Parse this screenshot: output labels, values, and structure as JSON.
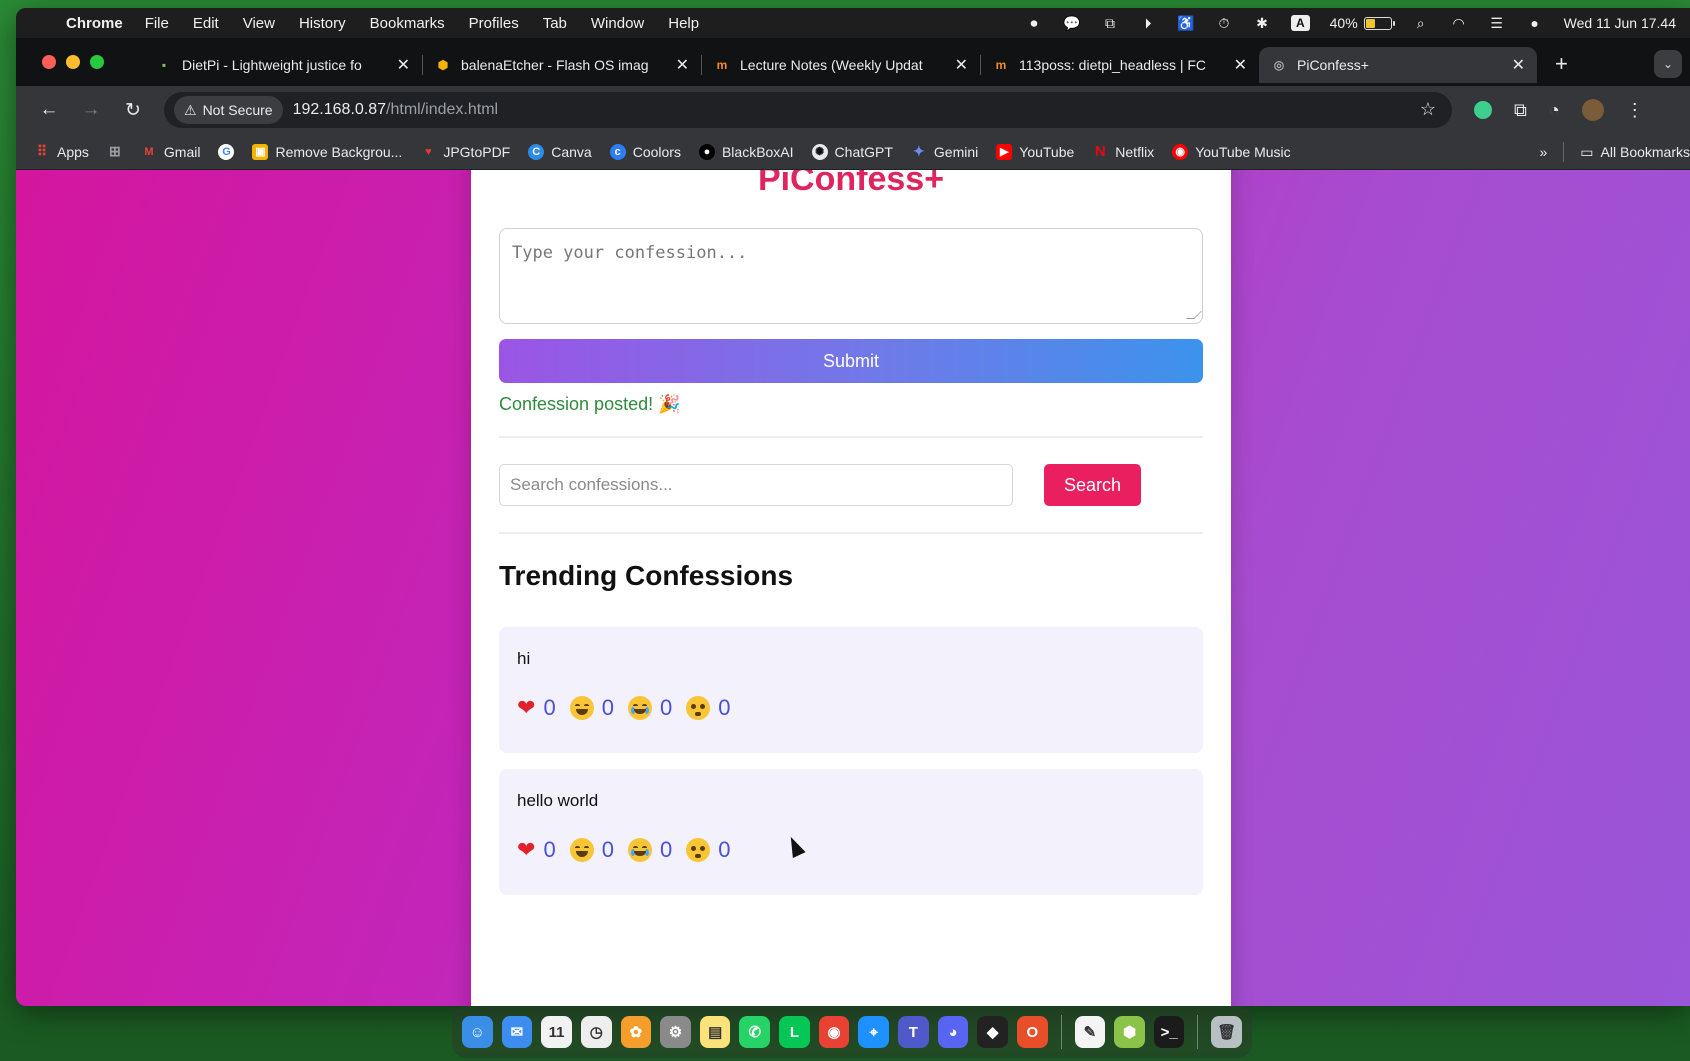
{
  "menubar": {
    "app_name": "Chrome",
    "menus": [
      "File",
      "Edit",
      "View",
      "History",
      "Bookmarks",
      "Profiles",
      "Tab",
      "Window",
      "Help"
    ],
    "battery_percent": "40%",
    "battery_level": 0.4,
    "keyboard_badge": "A",
    "clock": "Wed 11 Jun  17.44"
  },
  "tabs": [
    {
      "title": "DietPi - Lightweight justice fo",
      "icon": "dietpi-icon",
      "active": false
    },
    {
      "title": "balenaEtcher - Flash OS imag",
      "icon": "balena-icon",
      "active": false
    },
    {
      "title": "Lecture Notes (Weekly Updat",
      "icon": "notes-icon",
      "active": false
    },
    {
      "title": "113poss: dietpi_headless | FC",
      "icon": "notes-icon",
      "active": false
    },
    {
      "title": "PiConfess+",
      "icon": "globe-icon",
      "active": true
    }
  ],
  "toolbar": {
    "security_label": "Not Secure",
    "url_host": "192.168.0.87",
    "url_path": "/html/index.html"
  },
  "bookmarks": {
    "items": [
      {
        "label": "Apps",
        "icon": "apps-grid-icon",
        "color": "#ea4335"
      },
      {
        "label": "",
        "icon": "tab-groups-icon",
        "color": "#9aa0a6"
      },
      {
        "label": "Gmail",
        "icon": "gmail-icon",
        "color": "#ea4335"
      },
      {
        "label": "",
        "icon": "google-icon",
        "color": "#4285f4"
      },
      {
        "label": "Remove Backgrou...",
        "icon": "remove-bg-icon",
        "color": "#f5b400"
      },
      {
        "label": "JPGtoPDF",
        "icon": "jpgtopdf-icon",
        "color": "#e33b2e"
      },
      {
        "label": "Canva",
        "icon": "canva-icon",
        "color": "#2b8be6"
      },
      {
        "label": "Coolors",
        "icon": "coolors-icon",
        "color": "#2f7df6"
      },
      {
        "label": "BlackBoxAI",
        "icon": "blackbox-icon",
        "color": "#000000"
      },
      {
        "label": "ChatGPT",
        "icon": "chatgpt-icon",
        "color": "#e8eaed"
      },
      {
        "label": "Gemini",
        "icon": "gemini-icon",
        "color": "#6d8cf7"
      },
      {
        "label": "YouTube",
        "icon": "youtube-icon",
        "color": "#ff0000"
      },
      {
        "label": "Netflix",
        "icon": "netflix-icon",
        "color": "#e50914"
      },
      {
        "label": "YouTube Music",
        "icon": "youtube-music-icon",
        "color": "#ff0000"
      }
    ],
    "more_label": "»",
    "all_bookmarks": "All Bookmarks"
  },
  "page": {
    "title": "PiConfess+",
    "confession_placeholder": "Type your confession...",
    "submit_label": "Submit",
    "post_status": "Confession posted! 🎉",
    "search_placeholder": "Search confessions...",
    "search_label": "Search",
    "trending_heading": "Trending Confessions",
    "confessions": [
      {
        "text": "hi",
        "reactions": [
          {
            "icon": "heart-icon",
            "count": "0"
          },
          {
            "icon": "laughing-face-icon",
            "count": "0"
          },
          {
            "icon": "crying-face-icon",
            "count": "0"
          },
          {
            "icon": "flushed-face-icon",
            "count": "0"
          }
        ]
      },
      {
        "text": "hello world",
        "reactions": [
          {
            "icon": "heart-icon",
            "count": "0"
          },
          {
            "icon": "laughing-face-icon",
            "count": "0"
          },
          {
            "icon": "crying-face-icon",
            "count": "0"
          },
          {
            "icon": "flushed-face-icon",
            "count": "0"
          }
        ]
      }
    ]
  },
  "dock": {
    "apps": [
      {
        "icon": "finder-icon",
        "color": "#3a8ee6"
      },
      {
        "icon": "mail-icon",
        "color": "#3d8df0"
      },
      {
        "icon": "calendar-icon",
        "color": "#f2f2f2",
        "label": "11"
      },
      {
        "icon": "clock-icon",
        "color": "#eeeeee"
      },
      {
        "icon": "photos-icon",
        "color": "#f59e2b"
      },
      {
        "icon": "settings-icon",
        "color": "#8a8a8a"
      },
      {
        "icon": "notes-app-icon",
        "color": "#fbe27a"
      },
      {
        "icon": "whatsapp-icon",
        "color": "#25d366"
      },
      {
        "icon": "line-icon",
        "color": "#06c755"
      },
      {
        "icon": "chrome-icon",
        "color": "#e94235"
      },
      {
        "icon": "safari-icon",
        "color": "#1e90ff"
      },
      {
        "icon": "teams-icon",
        "color": "#5059c9"
      },
      {
        "icon": "discord-icon",
        "color": "#5865f2"
      },
      {
        "icon": "unity-icon",
        "color": "#222222"
      },
      {
        "icon": "office-icon",
        "color": "#e94e2a"
      },
      {
        "icon": "textedit-icon",
        "color": "#f4f4f4"
      },
      {
        "icon": "cube-icon",
        "color": "#8bc34a"
      },
      {
        "icon": "terminal-icon",
        "color": "#1b1b1b"
      },
      {
        "icon": "trash-icon",
        "color": "#b9c0c4"
      }
    ]
  }
}
